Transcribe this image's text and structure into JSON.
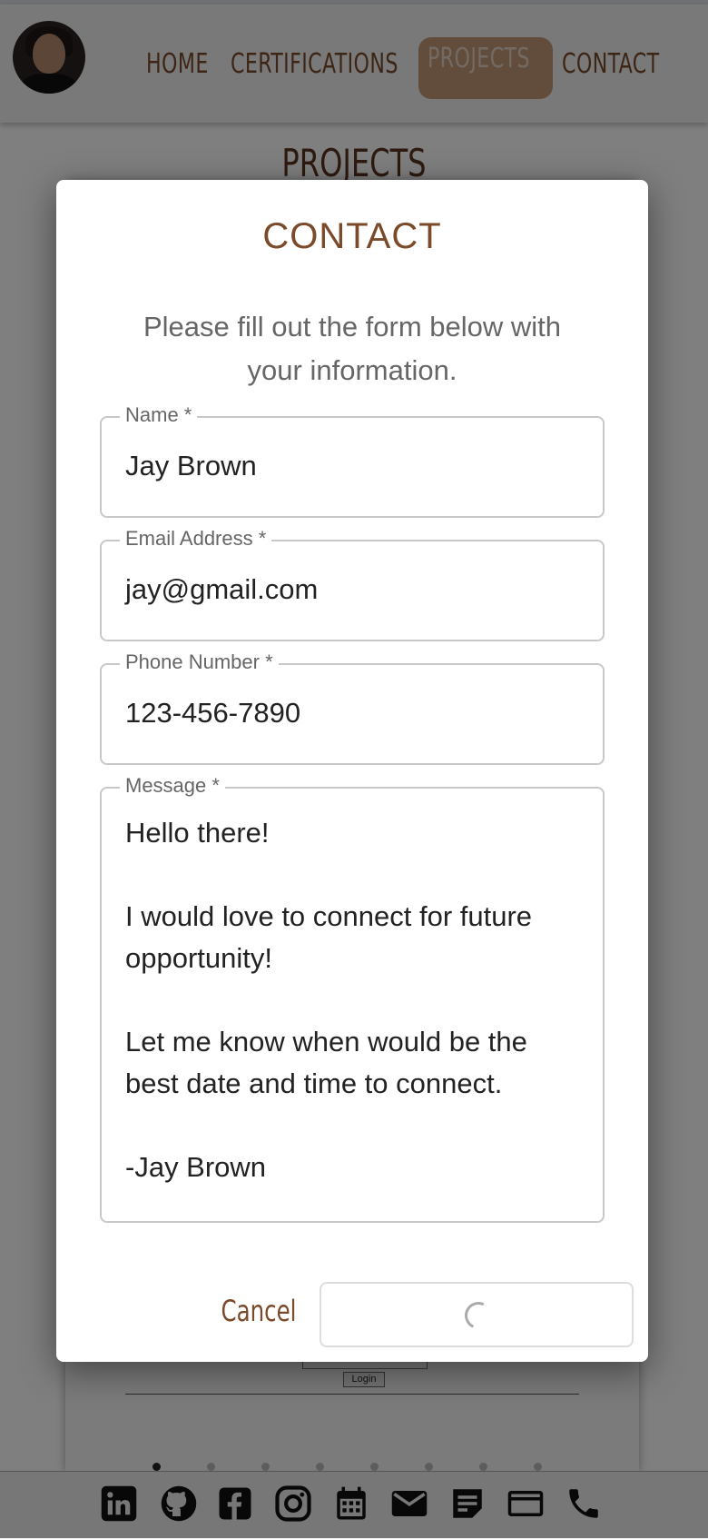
{
  "nav": {
    "items": [
      {
        "label": "HOME",
        "active": false
      },
      {
        "label": "CERTIFICATIONS",
        "active": false
      },
      {
        "label": "PROJECTS",
        "active": true
      },
      {
        "label": "CONTACT",
        "active": false
      }
    ],
    "avatar_icon": "profile-photo"
  },
  "page": {
    "heading": "PROJECTS",
    "login_label": "Login",
    "carousel": {
      "total": 8,
      "current": 1
    }
  },
  "modal": {
    "title": "CONTACT",
    "description": "Please fill out the form below with your information.",
    "fields": {
      "name": {
        "label": "Name *",
        "value": "Jay Brown"
      },
      "email": {
        "label": "Email Address *",
        "value": "jay@gmail.com"
      },
      "phone": {
        "label": "Phone Number *",
        "value": "123-456-7890"
      },
      "message": {
        "label": "Message *",
        "value": "Hello there!\n\nI would love to connect for future opportunity!\n\nLet me know when would be the best date and time to connect.\n\n-Jay Brown"
      }
    },
    "cancel_label": "Cancel",
    "submit_state": "loading"
  },
  "footer": {
    "icons": [
      "linkedin-icon",
      "github-icon",
      "facebook-icon",
      "instagram-icon",
      "calendar-icon",
      "mail-icon",
      "note-icon",
      "credit-card-icon",
      "phone-icon"
    ]
  },
  "colors": {
    "accent_brown": "#7a4a2a",
    "active_nav_bg": "#c49a78",
    "overlay": "rgba(0,0,0,0.5)"
  }
}
